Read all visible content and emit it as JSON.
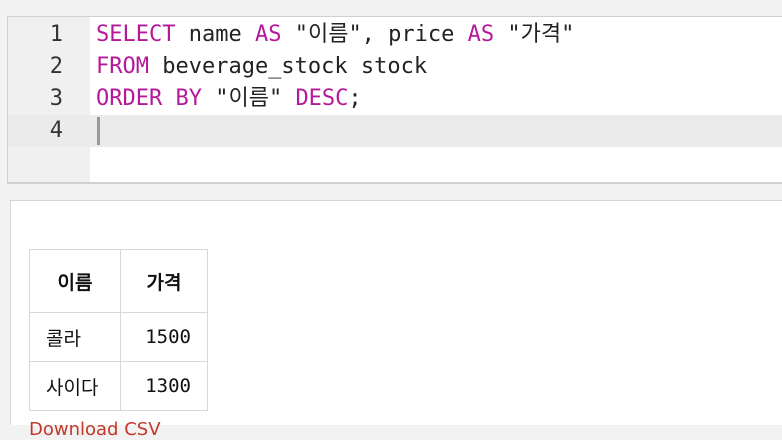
{
  "editor": {
    "line_numbers": [
      "1",
      "2",
      "3",
      "4"
    ],
    "lines": [
      [
        {
          "t": "SELECT",
          "kw": true
        },
        {
          "t": " name ",
          "kw": false
        },
        {
          "t": "AS",
          "kw": true
        },
        {
          "t": " \"이름\", price ",
          "kw": false
        },
        {
          "t": "AS",
          "kw": true
        },
        {
          "t": " \"가격\"",
          "kw": false
        }
      ],
      [
        {
          "t": "FROM",
          "kw": true
        },
        {
          "t": " beverage_stock stock",
          "kw": false
        }
      ],
      [
        {
          "t": "ORDER BY",
          "kw": true
        },
        {
          "t": " \"이름\" ",
          "kw": false
        },
        {
          "t": "DESC",
          "kw": true
        },
        {
          "t": ";",
          "kw": false
        }
      ],
      []
    ],
    "keyword_color": "#b5199a"
  },
  "result": {
    "columns": [
      "이름",
      "가격"
    ],
    "rows": [
      [
        "콜라",
        "1500"
      ],
      [
        "사이다",
        "1300"
      ]
    ],
    "footer_link": "Download CSV"
  }
}
